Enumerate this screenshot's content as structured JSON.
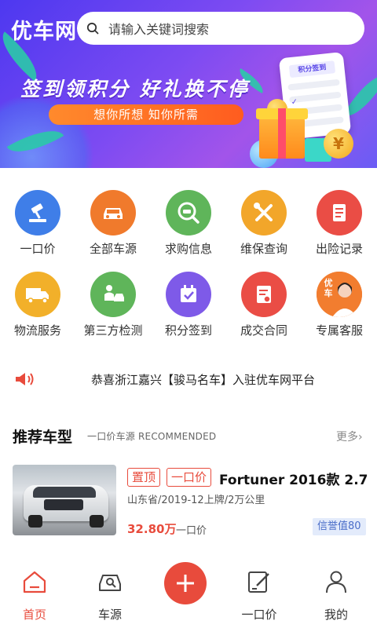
{
  "app": {
    "logo": "优车网"
  },
  "search": {
    "placeholder": "请输入关键词搜索"
  },
  "banner": {
    "slogan": "签到领积分 好礼换不停",
    "pill": "想你所想 知你所需",
    "phone_header": "积分签到"
  },
  "grid": {
    "items": [
      {
        "label": "一口价",
        "icon": "gavel-icon",
        "color": "#3f7ee8"
      },
      {
        "label": "全部车源",
        "icon": "car-icon",
        "color": "#f07a2c"
      },
      {
        "label": "求购信息",
        "icon": "car-search-icon",
        "color": "#5fb55a"
      },
      {
        "label": "维保查询",
        "icon": "wrench-icon",
        "color": "#f2a62a"
      },
      {
        "label": "出险记录",
        "icon": "scroll-icon",
        "color": "#ea4d45"
      },
      {
        "label": "物流服务",
        "icon": "truck-icon",
        "color": "#f2b02a"
      },
      {
        "label": "第三方检测",
        "icon": "inspection-icon",
        "color": "#5fb55a"
      },
      {
        "label": "积分签到",
        "icon": "calendar-check-icon",
        "color": "#7e5ae8"
      },
      {
        "label": "成交合同",
        "icon": "contract-icon",
        "color": "#ea4d45"
      },
      {
        "label": "专属客服",
        "icon": "agent-avatar",
        "color": "#f07a2c",
        "avatar_text": "优车"
      }
    ]
  },
  "notice": {
    "text": "恭喜浙江嘉兴【骏马名车】入驻优车网平台",
    "icon": "speaker-icon"
  },
  "section": {
    "title": "推荐车型",
    "subtitle": "一口价车源 RECOMMENDED",
    "more": "更多"
  },
  "car": {
    "tags": [
      "置顶",
      "一口价"
    ],
    "title": "Fortuner 2016款 2.7...",
    "meta": "山东省/2019-12上牌/2万公里",
    "price": "32.80万",
    "price_tag": "一口价",
    "credit": "信誉值80"
  },
  "tabbar": {
    "tabs": [
      {
        "label": "首页",
        "icon": "home-icon",
        "active": true
      },
      {
        "label": "车源",
        "icon": "car-source-icon",
        "active": false
      },
      {
        "label": "一口价",
        "icon": "edit-icon",
        "active": false
      },
      {
        "label": "我的",
        "icon": "user-icon",
        "active": false
      }
    ],
    "publish_icon": "plus-icon"
  },
  "colors": {
    "accent": "#e84b3c",
    "banner": "#6d45f0",
    "credit_bg": "#e3ebfb"
  }
}
